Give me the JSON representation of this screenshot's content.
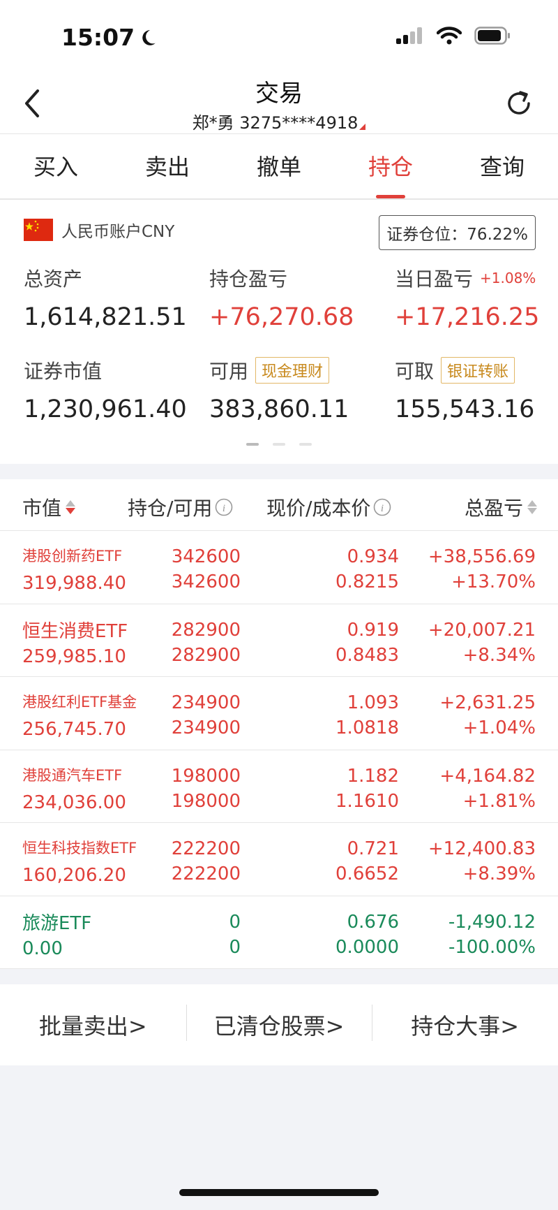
{
  "status_bar": {
    "time": "15:07"
  },
  "header": {
    "title": "交易",
    "account": "郑*勇 3275****4918"
  },
  "tabs": [
    "买入",
    "卖出",
    "撤单",
    "持仓",
    "查询"
  ],
  "active_tab": "持仓",
  "account": {
    "currency": "人民币账户CNY",
    "position_ratio": "证券仓位：76.22%",
    "total_assets_label": "总资产",
    "total_assets": "1,614,821.51",
    "holding_pnl_label": "持仓盈亏",
    "holding_pnl": "+76,270.68",
    "daily_pnl_label": "当日盈亏",
    "daily_pnl_pct": "+1.08%",
    "daily_pnl": "+17,216.25",
    "market_value_label": "证券市值",
    "market_value": "1,230,961.40",
    "available_label": "可用",
    "available_tag": "现金理财",
    "available": "383,860.11",
    "withdrawable_label": "可取",
    "withdrawable_tag": "银证转账",
    "withdrawable": "155,543.16"
  },
  "table": {
    "headers": {
      "market_value": "市值",
      "position": "持仓/可用",
      "price": "现价/成本价",
      "pnl": "总盈亏"
    },
    "rows": [
      {
        "name": "港股创新药ETF",
        "market_value": "319,988.40",
        "holding": "342600",
        "available": "342600",
        "price": "0.934",
        "cost": "0.8215",
        "pnl": "+38,556.69",
        "pnl_pct": "+13.70%"
      },
      {
        "name": "恒生消费ETF",
        "market_value": "259,985.10",
        "holding": "282900",
        "available": "282900",
        "price": "0.919",
        "cost": "0.8483",
        "pnl": "+20,007.21",
        "pnl_pct": "+8.34%"
      },
      {
        "name": "港股红利ETF基金",
        "market_value": "256,745.70",
        "holding": "234900",
        "available": "234900",
        "price": "1.093",
        "cost": "1.0818",
        "pnl": "+2,631.25",
        "pnl_pct": "+1.04%"
      },
      {
        "name": "港股通汽车ETF",
        "market_value": "234,036.00",
        "holding": "198000",
        "available": "198000",
        "price": "1.182",
        "cost": "1.1610",
        "pnl": "+4,164.82",
        "pnl_pct": "+1.81%"
      },
      {
        "name": "恒生科技指数ETF",
        "market_value": "160,206.20",
        "holding": "222200",
        "available": "222200",
        "price": "0.721",
        "cost": "0.6652",
        "pnl": "+12,400.83",
        "pnl_pct": "+8.39%"
      },
      {
        "name": "旅游ETF",
        "market_value": "0.00",
        "holding": "0",
        "available": "0",
        "price": "0.676",
        "cost": "0.0000",
        "pnl": "-1,490.12",
        "pnl_pct": "-100.00%"
      }
    ]
  },
  "actions": [
    "批量卖出>",
    "已清仓股票>",
    "持仓大事>"
  ],
  "colors": {
    "up": "#e0403a",
    "down": "#1a8a5a",
    "tag": "#c88a1e"
  }
}
